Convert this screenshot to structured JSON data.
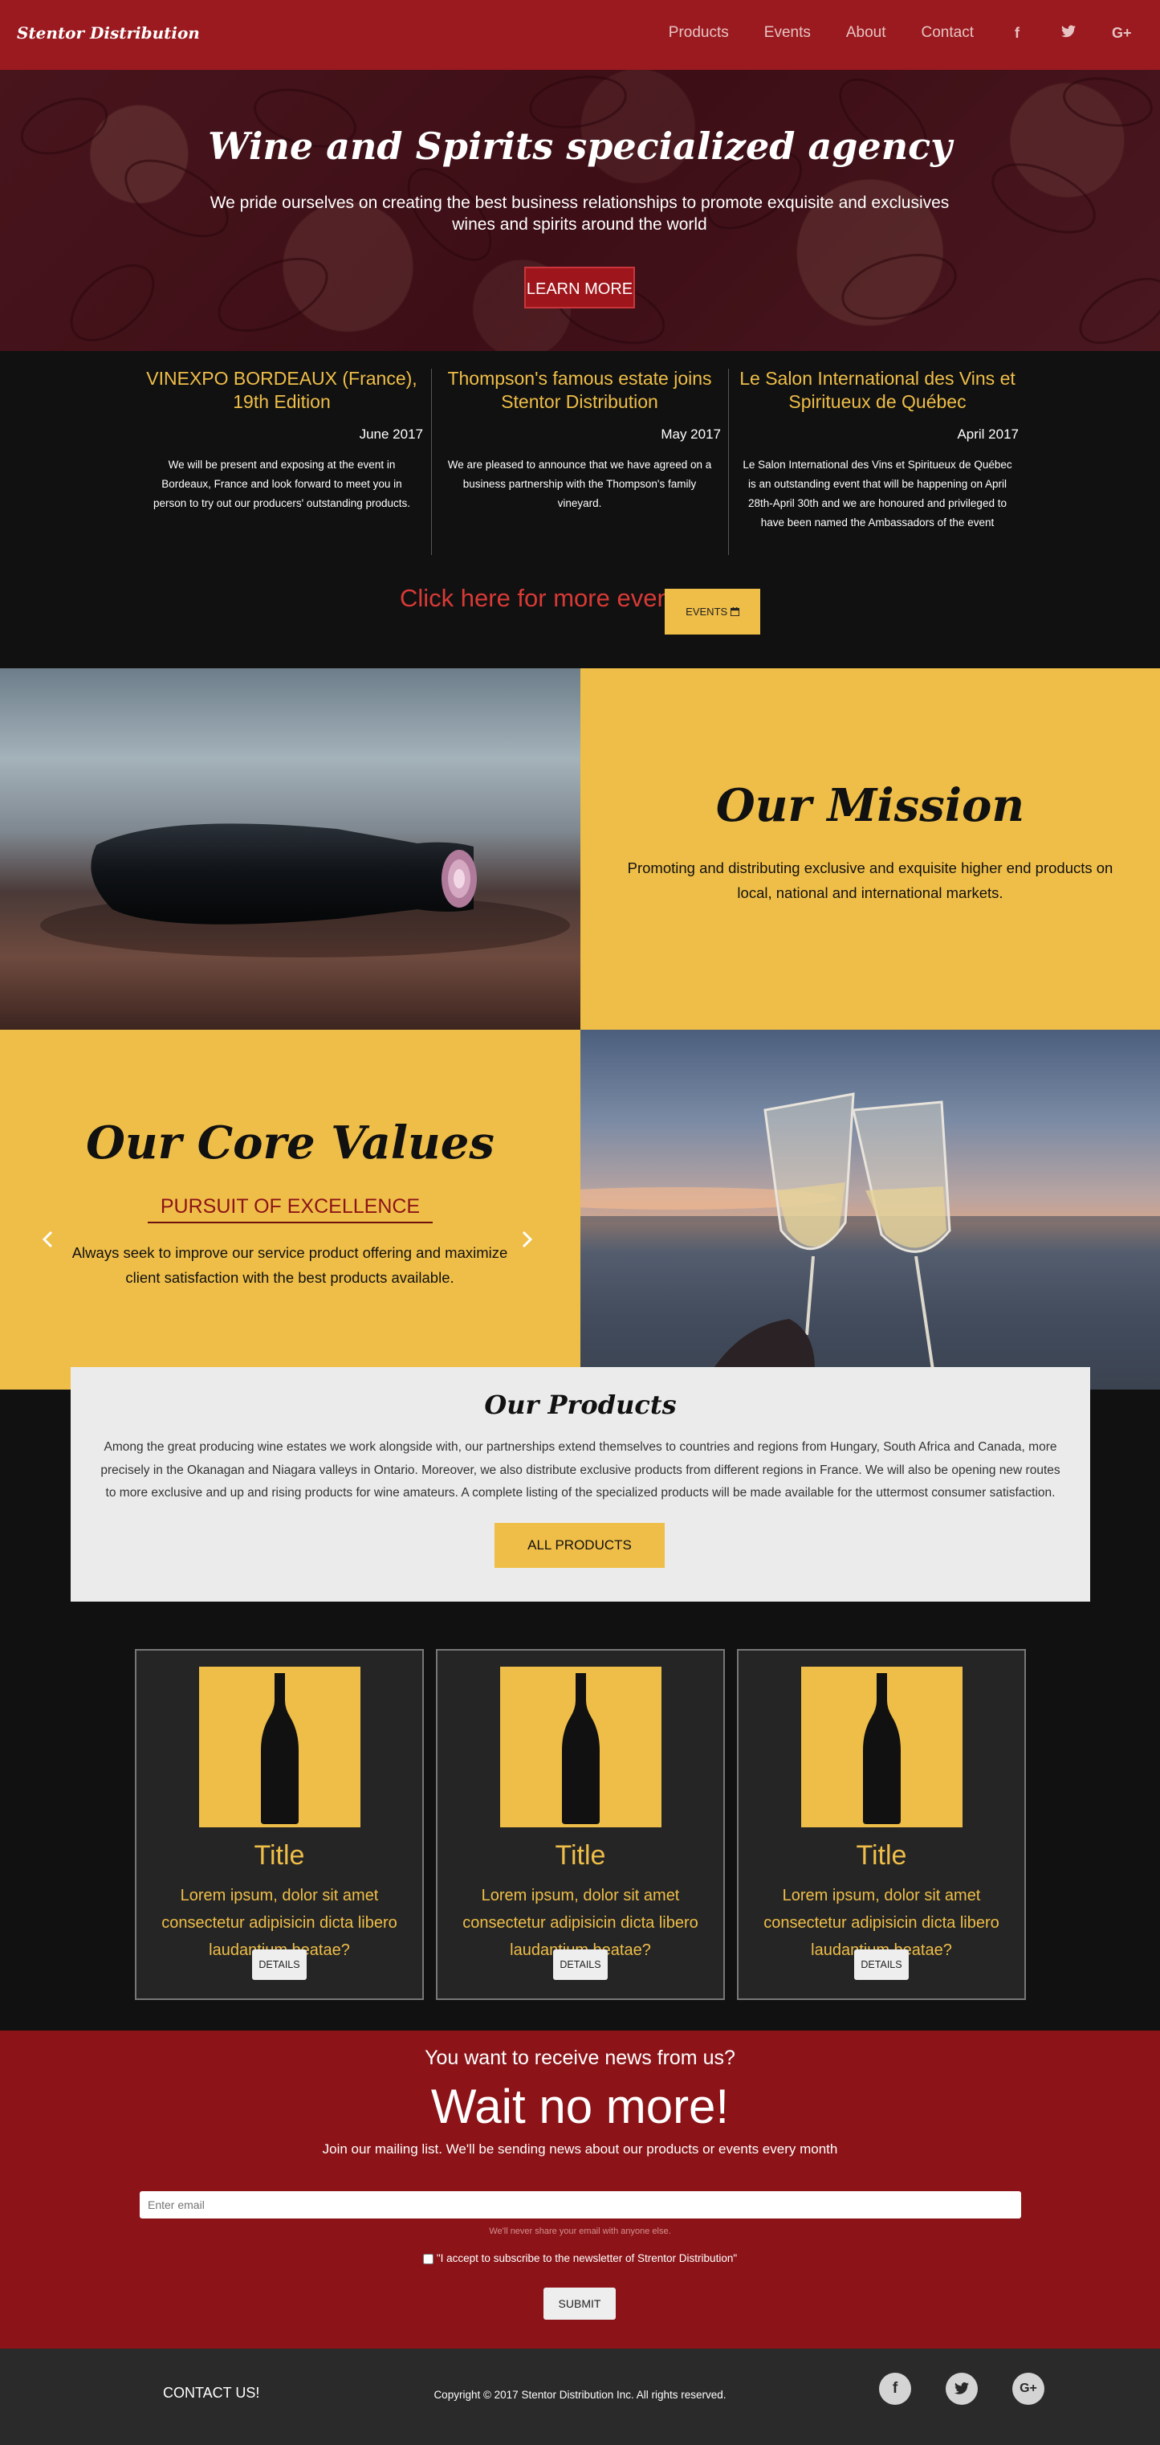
{
  "nav": {
    "brand": "Stentor Distribution",
    "links": [
      "Products",
      "Events",
      "About",
      "Contact"
    ],
    "social": {
      "facebook": "f",
      "twitter": "t",
      "googleplus": "G+"
    }
  },
  "hero": {
    "title": "Wine and Spirits specialized agency",
    "subtitle": "We pride ourselves on creating the best business relationships to promote exquisite and exclusives wines and spirits around the world",
    "button": "LEARN MORE"
  },
  "events": {
    "items": [
      {
        "title": "VINEXPO BORDEAUX (France), 19th Edition",
        "date": "June 2017",
        "text": "We will be present and exposing at the event in Bordeaux, France and look forward to meet you in person to try out our producers' outstanding products."
      },
      {
        "title": "Thompson's famous estate joins Stentor Distribution",
        "date": "May 2017",
        "text": "We are pleased to announce that we have agreed on a business partnership with the Thompson's family vineyard."
      },
      {
        "title": "Le Salon International des Vins et Spiritueux de Québec",
        "date": "April 2017",
        "text": "Le Salon International des Vins et Spiritueux de Québec is an outstanding event that will be happening on April 28th-April 30th and we are honoured and privileged to have been named the Ambassadors of the event"
      }
    ],
    "more_link": "Click here for more events!",
    "button": "EVENTS",
    "button_icon": "calendar-icon"
  },
  "mission": {
    "title": "Our Mission",
    "text": "Promoting and distributing exclusive and exquisite higher end products on local, national and international markets."
  },
  "values": {
    "title": "Our Core Values",
    "subtitle": "PURSUIT OF EXCELLENCE",
    "text": "Always seek to improve our service product offering and maximize client satisfaction with the best products available.",
    "prev_icon": "chevron-left-icon",
    "next_icon": "chevron-right-icon"
  },
  "products": {
    "title": "Our Products",
    "text": "Among the great producing wine estates we work alongside with, our partnerships extend themselves to countries and regions from Hungary, South Africa and Canada, more precisely in the Okanagan and Niagara valleys in Ontario. Moreover, we also distribute exclusive products from different regions in France. We will also be opening new routes to more exclusive and up and rising products for wine amateurs. A complete listing of the specialized products will be made available for the uttermost consumer satisfaction.",
    "button": "ALL PRODUCTS"
  },
  "cards": [
    {
      "title": "Title",
      "desc": "Lorem ipsum, dolor sit amet consectetur adipisicin dicta libero laudantium beatae?",
      "button": "DETAILS"
    },
    {
      "title": "Title",
      "desc": "Lorem ipsum, dolor sit amet consectetur adipisicin dicta libero laudantium beatae?",
      "button": "DETAILS"
    },
    {
      "title": "Title",
      "desc": "Lorem ipsum, dolor sit amet consectetur adipisicin dicta libero laudantium beatae?",
      "button": "DETAILS"
    }
  ],
  "newsletter": {
    "pre": "You want to receive news from us?",
    "headline": "Wait no more!",
    "desc": "Join our mailing list. We'll be sending news about our products or events every month",
    "email_placeholder": "Enter email",
    "note": "We'll never share your email with anyone else.",
    "consent": "\"I accept to subscribe to the newsletter of Strentor Distribution\"",
    "submit": "SUBMIT"
  },
  "footer": {
    "contact": "CONTACT US!",
    "copyright": "Copyright © 2017 Stentor Distribution Inc. All rights reserved.",
    "social": {
      "facebook": "f",
      "twitter": "t",
      "googleplus": "G+"
    }
  },
  "colors": {
    "brand_red": "#9a1a1f",
    "gold": "#efbe48",
    "dark": "#111111"
  }
}
